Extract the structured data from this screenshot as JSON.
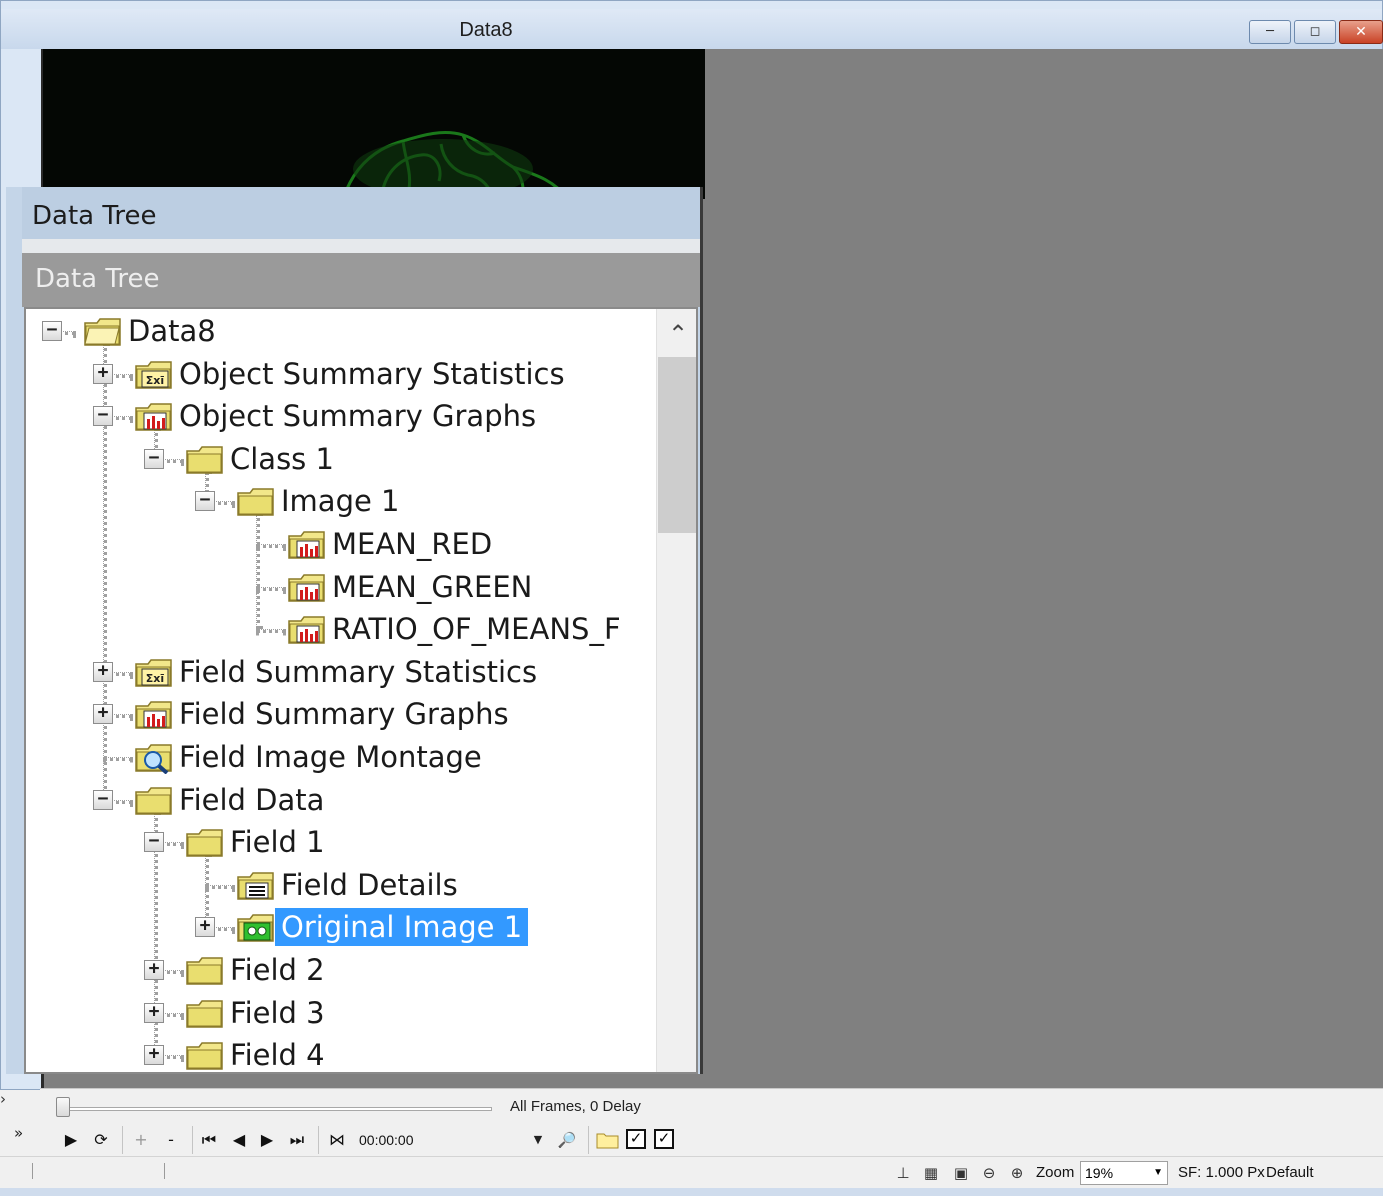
{
  "window": {
    "title": "Data8"
  },
  "panel": {
    "title": "Data Tree",
    "subtitle": "Data Tree"
  },
  "tree": [
    {
      "label": "Data8",
      "icon": "folder-open-icon",
      "expander": "-"
    },
    {
      "label": "Object Summary Statistics",
      "icon": "statistics-icon",
      "expander": "+"
    },
    {
      "label": "Object Summary Graphs",
      "icon": "bar-graph-icon",
      "expander": "-"
    },
    {
      "label": "Class 1",
      "icon": "folder-icon",
      "expander": "-"
    },
    {
      "label": "Image 1",
      "icon": "folder-icon",
      "expander": "-"
    },
    {
      "label": "MEAN_RED",
      "icon": "bar-graph-icon",
      "expander": ""
    },
    {
      "label": "MEAN_GREEN",
      "icon": "bar-graph-icon",
      "expander": ""
    },
    {
      "label": "RATIO_OF_MEANS_F",
      "icon": "bar-graph-icon",
      "expander": ""
    },
    {
      "label": "Field Summary Statistics",
      "icon": "statistics-icon",
      "expander": "+"
    },
    {
      "label": "Field Summary Graphs",
      "icon": "bar-graph-icon",
      "expander": "+"
    },
    {
      "label": "Field Image Montage",
      "icon": "montage-icon",
      "expander": ""
    },
    {
      "label": "Field Data",
      "icon": "folder-icon",
      "expander": "-"
    },
    {
      "label": "Field 1",
      "icon": "folder-icon",
      "expander": "-"
    },
    {
      "label": "Field Details",
      "icon": "details-icon",
      "expander": ""
    },
    {
      "label": "Original Image 1",
      "icon": "original-image-icon",
      "expander": "+",
      "selected": true
    },
    {
      "label": "Field 2",
      "icon": "folder-icon",
      "expander": "+"
    },
    {
      "label": "Field 3",
      "icon": "folder-icon",
      "expander": "+"
    },
    {
      "label": "Field 4",
      "icon": "folder-icon",
      "expander": "+"
    }
  ],
  "timeline": {
    "label": "All Frames, 0 Delay",
    "position": 0
  },
  "playbar": {
    "time": "00:00:00",
    "plus": "+",
    "minus": "-"
  },
  "status": {
    "zoom_label": "Zoom",
    "zoom_value": "19%",
    "sf": "SF: 1.000 Px",
    "mode": "Default"
  },
  "colors": {
    "selection": "#3399ff",
    "workspace": "#808080",
    "image_green": "#2aa32a"
  }
}
